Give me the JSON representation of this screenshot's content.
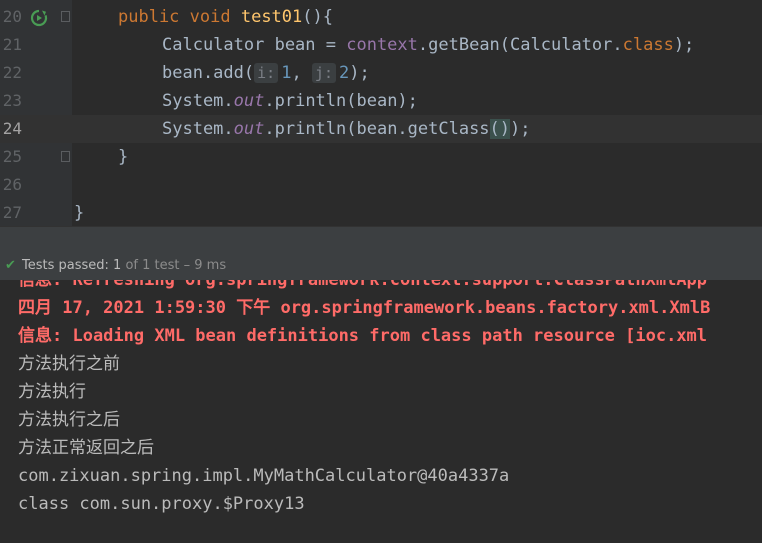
{
  "editor": {
    "lines": [
      {
        "num": "20",
        "tokens": [
          [
            "kw",
            "public "
          ],
          [
            "kw",
            "void "
          ],
          [
            "fn",
            "test01"
          ],
          [
            "p",
            "(){"
          ]
        ]
      },
      {
        "num": "21",
        "tokens": [
          [
            "p",
            "Calculator bean = "
          ],
          [
            "field",
            "context"
          ],
          [
            "p",
            "."
          ],
          [
            "p",
            "getBean"
          ],
          [
            "p",
            "(Calculator."
          ],
          [
            "kw",
            "class"
          ],
          [
            "p",
            ");"
          ]
        ]
      },
      {
        "num": "22",
        "tokens": [
          [
            "p",
            "bean.add("
          ],
          [
            "hint",
            "i:"
          ],
          [
            "num",
            "1"
          ],
          [
            "p",
            ", "
          ],
          [
            "hint",
            "j:"
          ],
          [
            "num",
            "2"
          ],
          [
            "p",
            ");"
          ]
        ]
      },
      {
        "num": "23",
        "tokens": [
          [
            "p",
            "System."
          ],
          [
            "italic",
            "out"
          ],
          [
            "p",
            ".println(bean);"
          ]
        ]
      },
      {
        "num": "24",
        "tokens": [
          [
            "p",
            "System."
          ],
          [
            "italic",
            "out"
          ],
          [
            "p",
            ".println(bean.getClass"
          ],
          [
            "hl",
            "()"
          ],
          [
            "p",
            ");"
          ]
        ]
      },
      {
        "num": "25",
        "tokens": [
          [
            "p",
            "}"
          ]
        ]
      },
      {
        "num": "26",
        "tokens": []
      },
      {
        "num": "27",
        "tokens": [
          [
            "p",
            "}"
          ]
        ]
      }
    ]
  },
  "status": {
    "label": "Tests passed:",
    "passed": "1",
    "detail": "of 1 test – 9 ms"
  },
  "console": {
    "lines": [
      {
        "text": "信息: Refreshing org.springframework.context.support.ClassPathXmlApp",
        "style": "red"
      },
      {
        "text": "四月 17, 2021 1:59:30 下午 org.springframework.beans.factory.xml.XmlB",
        "style": "red"
      },
      {
        "text": "信息: Loading XML bean definitions from class path resource [ioc.xml",
        "style": "red"
      },
      {
        "text": "方法执行之前",
        "style": "cn"
      },
      {
        "text": "方法执行",
        "style": "cn"
      },
      {
        "text": "方法执行之后",
        "style": "cn"
      },
      {
        "text": "方法正常返回之后",
        "style": "cn"
      },
      {
        "text": "com.zixuan.spring.impl.MyMathCalculator@40a4337a",
        "style": "plain"
      },
      {
        "text": "class com.sun.proxy.$Proxy13",
        "style": "plain"
      }
    ]
  },
  "icons": {
    "run_icon": "run-test-icon",
    "fold_icon": "fold-icon",
    "check_icon": "check-icon"
  },
  "colors": {
    "background": "#2b2b2b",
    "keyword": "#cc7832",
    "function": "#ffc66d",
    "field": "#9876aa",
    "number": "#6897bb",
    "error_text": "#ff6b68",
    "pass_green": "#499c54"
  }
}
